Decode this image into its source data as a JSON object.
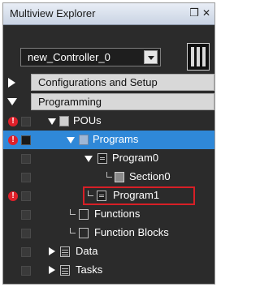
{
  "panel": {
    "title": "Multiview Explorer",
    "pin_glyph": "❒",
    "close_glyph": "✕"
  },
  "controller": {
    "selected": "new_Controller_0"
  },
  "tree": {
    "configurations": "Configurations and Setup",
    "programming": "Programming",
    "pous": "POUs",
    "programs": "Programs",
    "program0": "Program0",
    "section0": "Section0",
    "program1": "Program1",
    "functions": "Functions",
    "function_blocks": "Function Blocks",
    "data": "Data",
    "tasks": "Tasks"
  },
  "icons": {
    "error": "!",
    "selection_color": "#2f88d8",
    "highlight_color": "#d71f26"
  }
}
